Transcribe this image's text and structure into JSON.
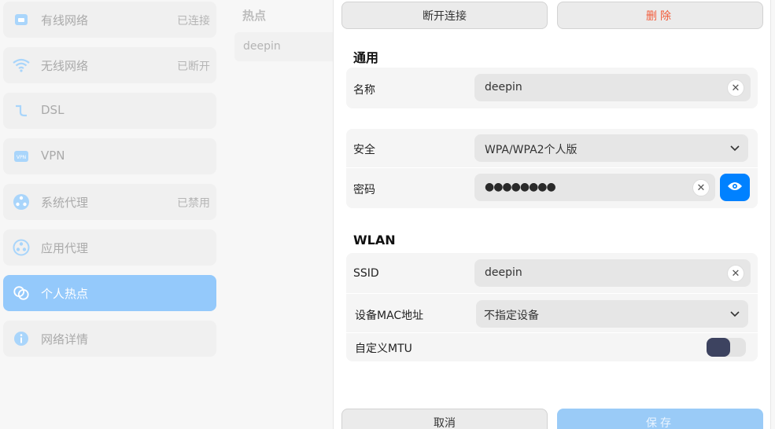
{
  "sidebar": {
    "items": [
      {
        "label": "有线网络",
        "status": "已连接",
        "icon": "wired-network-icon"
      },
      {
        "label": "无线网络",
        "status": "已断开",
        "icon": "wifi-icon"
      },
      {
        "label": "DSL",
        "status": "",
        "icon": "dsl-icon"
      },
      {
        "label": "VPN",
        "status": "",
        "icon": "vpn-icon"
      },
      {
        "label": "系统代理",
        "status": "已禁用",
        "icon": "system-proxy-icon"
      },
      {
        "label": "应用代理",
        "status": "",
        "icon": "app-proxy-icon"
      },
      {
        "label": "个人热点",
        "status": "",
        "icon": "hotspot-icon",
        "active": true
      },
      {
        "label": "网络详情",
        "status": "",
        "icon": "info-icon"
      }
    ]
  },
  "middle": {
    "title": "热点",
    "items": [
      {
        "label": "deepin"
      }
    ]
  },
  "panel": {
    "disconnect_label": "断开连接",
    "delete_label": "删除",
    "general": {
      "title": "通用",
      "name_label": "名称",
      "name_value": "deepin"
    },
    "security": {
      "security_label": "安全",
      "security_value": "WPA/WPA2个人版",
      "password_label": "密码",
      "password_value": "●●●●●●●●"
    },
    "wlan": {
      "title": "WLAN",
      "ssid_label": "SSID",
      "ssid_value": "deepin",
      "mac_label": "设备MAC地址",
      "mac_value": "不指定设备",
      "mtu_label": "自定义MTU",
      "mtu_enabled": false
    },
    "cancel_label": "取消",
    "save_label": "保存"
  },
  "colors": {
    "accent": "#0081ff",
    "active_item": "#94c9fb",
    "danger": "#f25c3b",
    "save_button": "#9acbf7"
  }
}
